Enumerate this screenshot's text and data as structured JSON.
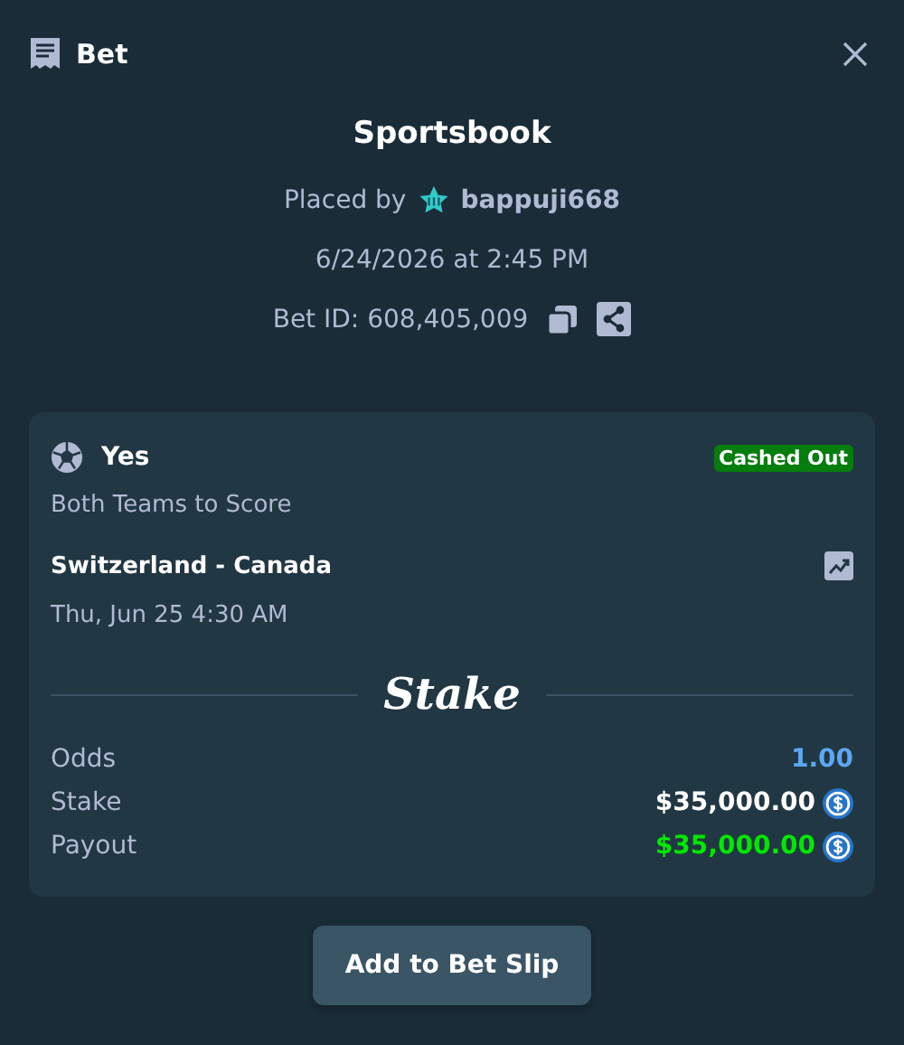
{
  "header": {
    "title": "Bet"
  },
  "summary": {
    "title": "Sportsbook",
    "placed_by_label": "Placed by",
    "user": "bappuji668",
    "date": "6/24/2026 at 2:45 PM",
    "bet_id": "Bet ID: 608,405,009"
  },
  "selection": {
    "outcome": "Yes",
    "status": "Cashed Out",
    "market": "Both Teams to Score",
    "event": "Switzerland - Canada",
    "start": "Thu, Jun 25  4:30 AM"
  },
  "brand": "Stake",
  "details": [
    {
      "label": "Odds",
      "value": "1.00",
      "kind": "odds"
    },
    {
      "label": "Stake",
      "value": "$35,000.00",
      "kind": "amount"
    },
    {
      "label": "Payout",
      "value": "$35,000.00",
      "kind": "payout"
    }
  ],
  "actions": [
    "Add to Bet Slip"
  ]
}
